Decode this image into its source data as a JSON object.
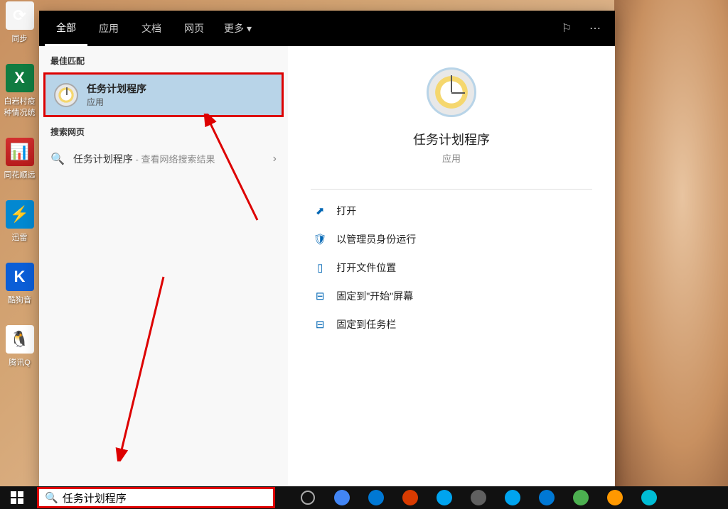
{
  "desktop_icons": [
    {
      "label": "同步",
      "cls": "ico-sync",
      "glyph": "⟳"
    },
    {
      "label": "白岩村疫\n种情况统",
      "cls": "ico-excel",
      "glyph": "X"
    },
    {
      "label": "同花顺远",
      "cls": "ico-red",
      "glyph": "📊"
    },
    {
      "label": "迅雷",
      "cls": "ico-thunder",
      "glyph": "⚡"
    },
    {
      "label": "酷狗音",
      "cls": "ico-kugou",
      "glyph": "K"
    },
    {
      "label": "腾讯Q",
      "cls": "ico-qq",
      "glyph": "🐧"
    }
  ],
  "header": {
    "tabs": [
      "全部",
      "应用",
      "文档",
      "网页"
    ],
    "more": "更多"
  },
  "sections": {
    "best_match": "最佳匹配",
    "web_search": "搜索网页"
  },
  "match": {
    "title": "任务计划程序",
    "sub": "应用"
  },
  "web": {
    "text": "任务计划程序",
    "suffix": " - 查看网络搜索结果"
  },
  "detail": {
    "title": "任务计划程序",
    "sub": "应用"
  },
  "actions": [
    {
      "icon": "⬈",
      "label": "打开",
      "name": "action-open"
    },
    {
      "icon": "🛡",
      "label": "以管理员身份运行",
      "name": "action-run-admin"
    },
    {
      "icon": "▯",
      "label": "打开文件位置",
      "name": "action-file-location"
    },
    {
      "icon": "⊟",
      "label": "固定到\"开始\"屏幕",
      "name": "action-pin-start"
    },
    {
      "icon": "⊟",
      "label": "固定到任务栏",
      "name": "action-pin-taskbar"
    }
  ],
  "search_value": "任务计划程序",
  "taskbar_colors": [
    "#4285f4",
    "#0078d4",
    "#d83b01",
    "#00a4ef",
    "#606060",
    "#00a4ef",
    "#0078d4",
    "#4caf50",
    "#ff9800",
    "#00bcd4"
  ]
}
